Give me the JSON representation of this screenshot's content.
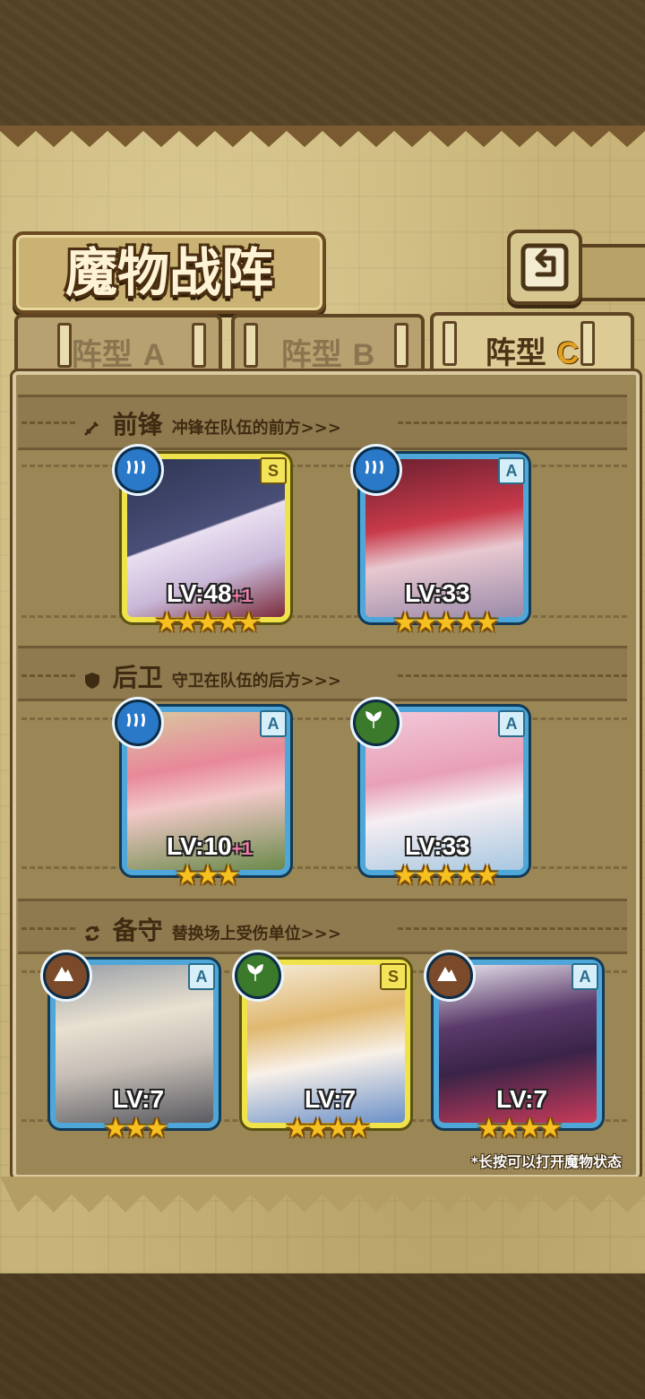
{
  "title": "魔物战阵",
  "tabs": [
    {
      "label": "阵型",
      "suffix": "A",
      "active": false
    },
    {
      "label": "阵型",
      "suffix": "B",
      "active": false
    },
    {
      "label": "阵型",
      "suffix": "C",
      "active": true
    }
  ],
  "sections": [
    {
      "name": "前锋",
      "desc": "冲锋在队伍的前方>>>",
      "icon": "sword-icon"
    },
    {
      "name": "后卫",
      "desc": "守卫在队伍的后方>>>",
      "icon": "shield-icon"
    },
    {
      "name": "备守",
      "desc": "替换场上受伤单位>>>",
      "icon": "swap-icon"
    }
  ],
  "monsters": {
    "front": [
      {
        "rank": "S",
        "element": "water",
        "level": "LV:48",
        "bonus": "+1",
        "stars": "★★★★★"
      },
      {
        "rank": "A",
        "element": "water",
        "level": "LV:33",
        "bonus": "",
        "stars": "★★★★★"
      }
    ],
    "back": [
      {
        "rank": "A",
        "element": "water",
        "level": "LV:10",
        "bonus": "+1",
        "stars": "★★★"
      },
      {
        "rank": "A",
        "element": "leaf",
        "level": "LV:33",
        "bonus": "",
        "stars": "★★★★★"
      }
    ],
    "reserve": [
      {
        "rank": "A",
        "element": "rock",
        "level": "LV:7",
        "bonus": "",
        "stars": "★★★"
      },
      {
        "rank": "S",
        "element": "leaf",
        "level": "LV:7",
        "bonus": "",
        "stars": "★★★★"
      },
      {
        "rank": "A",
        "element": "rock",
        "level": "LV:7",
        "bonus": "",
        "stars": "★★★★"
      }
    ]
  },
  "footnote": "*长按可以打开魔物状态",
  "colors": {
    "card_border_a": "#4fa6d8",
    "card_border_s": "#efe24a",
    "star": "#f5c020",
    "parchment": "#c8b478"
  }
}
